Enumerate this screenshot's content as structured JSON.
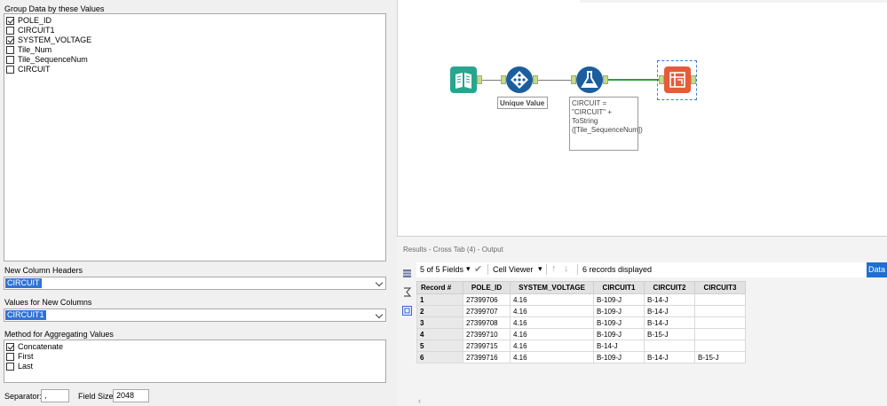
{
  "left_panel": {
    "group_label": "Group Data by these Values",
    "group_fields": [
      {
        "label": "POLE_ID",
        "checked": true
      },
      {
        "label": "CIRCUIT1",
        "checked": false
      },
      {
        "label": "SYSTEM_VOLTAGE",
        "checked": true
      },
      {
        "label": "Tile_Num",
        "checked": false
      },
      {
        "label": "Tile_SequenceNum",
        "checked": false
      },
      {
        "label": "CIRCUIT",
        "checked": false
      }
    ],
    "headers_label": "New Column Headers",
    "headers_value": "CIRCUIT",
    "values_label": "Values for New Columns",
    "values_value": "CIRCUIT1",
    "method_label": "Method for Aggregating Values",
    "methods": [
      {
        "label": "Concatenate",
        "checked": true
      },
      {
        "label": "First",
        "checked": false
      },
      {
        "label": "Last",
        "checked": false
      }
    ],
    "separator_label": "Separator:",
    "separator_value": ",",
    "field_size_label": "Field Size:",
    "field_size_value": "2048"
  },
  "canvas": {
    "unique_label": "Unique Value",
    "formula_annotation": "CIRCUIT = \"CIRCUIT\" + ToString ([Tile_SequenceNum])"
  },
  "results": {
    "title": "Results - Cross Tab (4) - Output",
    "fields_count": "5 of 5 Fields",
    "cell_viewer": "Cell Viewer",
    "records_displayed": "6 records displayed",
    "data_button": "Data",
    "columns": [
      "Record #",
      "POLE_ID",
      "SYSTEM_VOLTAGE",
      "CIRCUIT1",
      "CIRCUIT2",
      "CIRCUIT3"
    ],
    "rows": [
      [
        "1",
        "27399706",
        "4.16",
        "B-109-J",
        "B-14-J",
        ""
      ],
      [
        "2",
        "27399707",
        "4.16",
        "B-109-J",
        "B-14-J",
        ""
      ],
      [
        "3",
        "27399708",
        "4.16",
        "B-109-J",
        "B-14-J",
        ""
      ],
      [
        "4",
        "27399710",
        "4.16",
        "B-109-J",
        "B-15-J",
        ""
      ],
      [
        "5",
        "27399715",
        "4.16",
        "B-14-J",
        "",
        ""
      ],
      [
        "6",
        "27399716",
        "4.16",
        "B-109-J",
        "B-14-J",
        "B-15-J"
      ]
    ]
  },
  "colors": {
    "selection": "#3073d6",
    "data_button": "#1d6fd1",
    "input_tool": "#2aa58d",
    "unique_tool": "#1b5e9e",
    "formula_tool": "#1b5e9e",
    "crosstab_tool": "#e55b3c"
  }
}
